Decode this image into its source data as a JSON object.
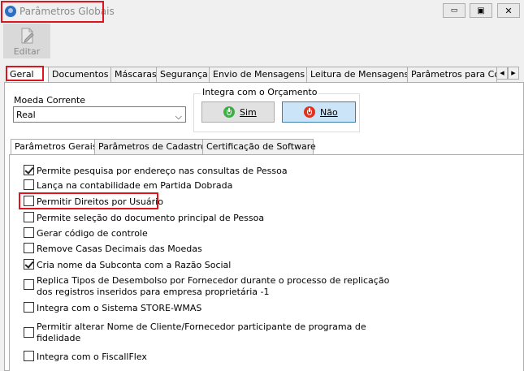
{
  "window": {
    "title": "Parâmetros Globais",
    "minimize_glyph": "▭",
    "restore_glyph": "▣",
    "close_glyph": "✕"
  },
  "toolbar": {
    "edit_label": "Editar",
    "edit_icon": "edit-document-icon"
  },
  "tabs": [
    {
      "label": "Geral",
      "active": true
    },
    {
      "label": "Documentos"
    },
    {
      "label": "Máscaras"
    },
    {
      "label": "Segurança"
    },
    {
      "label": "Envio de Mensagens"
    },
    {
      "label": "Leitura de Mensagens"
    },
    {
      "label": "Parâmetros para Co"
    }
  ],
  "tab_scroll": {
    "left": "◀",
    "right": "▶"
  },
  "currency": {
    "label": "Moeda Corrente",
    "value": "Real",
    "arrow": "⌵"
  },
  "budget": {
    "title": "Integra com o Orçamento",
    "yes_label": "Sim",
    "no_label": "Não"
  },
  "subtabs": [
    {
      "label": "Parâmetros Gerais",
      "active": true
    },
    {
      "label": "Parâmetros de Cadastro"
    },
    {
      "label": "Certificação de Software"
    }
  ],
  "options": [
    {
      "label": "Permite pesquisa por endereço nas consultas de Pessoa",
      "checked": true
    },
    {
      "label": "Lança na contabilidade em Partida Dobrada",
      "checked": false
    },
    {
      "label": "Permitir Direitos por Usuário",
      "checked": false
    },
    {
      "label": "Permite seleção do documento principal de Pessoa",
      "checked": false
    },
    {
      "label": "Gerar código de controle",
      "checked": false
    },
    {
      "label": "Remove Casas Decimais das Moedas",
      "checked": false
    },
    {
      "label": "Cria nome da Subconta com a Razão Social",
      "checked": true
    },
    {
      "label": "Replica Tipos de Desembolso por Fornecedor durante o processo de replicação",
      "label2": "dos registros inseridos para empresa proprietária -1",
      "checked": false
    },
    {
      "label": "Integra com o Sistema STORE-WMAS",
      "checked": false
    },
    {
      "label": "Permitir alterar Nome de Cliente/Fornecedor participante de programa de",
      "label2": "fidelidade",
      "checked": false
    },
    {
      "label": "Integra com o FiscallFlex",
      "checked": false
    }
  ],
  "colors": {
    "highlight": "#e0141e",
    "no_button": "#cce4f7",
    "power_yes": "#3fae49",
    "power_no": "#e0321e"
  }
}
